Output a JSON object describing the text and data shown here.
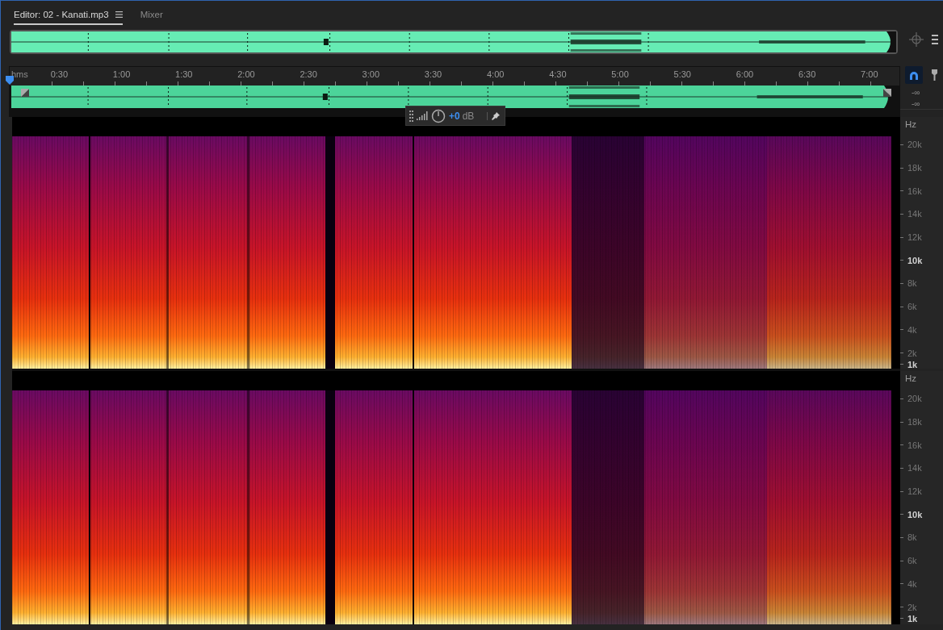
{
  "tabs": [
    {
      "label": "Editor: 02 - Kanati.mp3",
      "selected": true,
      "menu": true
    },
    {
      "label": "Mixer",
      "selected": false,
      "menu": false
    }
  ],
  "toolbar": {
    "snapping": true
  },
  "ruler": {
    "unit": "hms",
    "labels": [
      "0:30",
      "1:00",
      "1:30",
      "2:00",
      "2:30",
      "3:00",
      "3:30",
      "4:00",
      "4:30",
      "5:00",
      "5:30",
      "6:00",
      "6:30",
      "7:00"
    ]
  },
  "track": {
    "levels": [
      "-∞",
      "-∞"
    ]
  },
  "hud": {
    "gain": "+0",
    "unit": "dB"
  },
  "channels": [
    {
      "unit": "Hz",
      "labels": [
        {
          "text": "20k",
          "major": false
        },
        {
          "text": "18k",
          "major": false
        },
        {
          "text": "16k",
          "major": false
        },
        {
          "text": "14k",
          "major": false
        },
        {
          "text": "12k",
          "major": false
        },
        {
          "text": "10k",
          "major": true
        },
        {
          "text": "8k",
          "major": false
        },
        {
          "text": "6k",
          "major": false
        },
        {
          "text": "4k",
          "major": false
        },
        {
          "text": "2k",
          "major": false
        },
        {
          "text": "1k",
          "major": true
        }
      ]
    },
    {
      "unit": "Hz",
      "labels": [
        {
          "text": "20k",
          "major": false
        },
        {
          "text": "18k",
          "major": false
        },
        {
          "text": "16k",
          "major": false
        },
        {
          "text": "14k",
          "major": false
        },
        {
          "text": "12k",
          "major": false
        },
        {
          "text": "10k",
          "major": true
        },
        {
          "text": "8k",
          "major": false
        },
        {
          "text": "6k",
          "major": false
        },
        {
          "text": "4k",
          "major": false
        },
        {
          "text": "2k",
          "major": false
        },
        {
          "text": "1k",
          "major": true
        }
      ]
    }
  ]
}
